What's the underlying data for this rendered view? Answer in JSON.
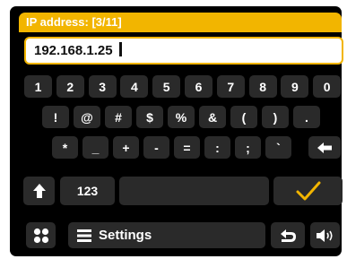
{
  "title": "IP address: [3/11]",
  "input": {
    "value": "192.168.1.25"
  },
  "rows": [
    [
      "1",
      "2",
      "3",
      "4",
      "5",
      "6",
      "7",
      "8",
      "9",
      "0"
    ],
    [
      "!",
      "@",
      "#",
      "$",
      "%",
      "&",
      "(",
      ")",
      "."
    ],
    [
      "*",
      "_",
      "+",
      "-",
      "=",
      ":",
      ";",
      "`"
    ]
  ],
  "keys": {
    "mode_label": "123",
    "settings_label": "Settings"
  },
  "colors": {
    "accent": "#f2b500",
    "key_bg": "#2a2a2a",
    "background": "#000000"
  },
  "icons": {
    "backspace": "backspace-arrow-icon",
    "shift": "shift-arrow-icon",
    "confirm": "checkmark-icon",
    "home": "grid-icon",
    "menu": "menu-lines-icon",
    "back": "return-arrow-icon",
    "volume": "speaker-icon"
  }
}
